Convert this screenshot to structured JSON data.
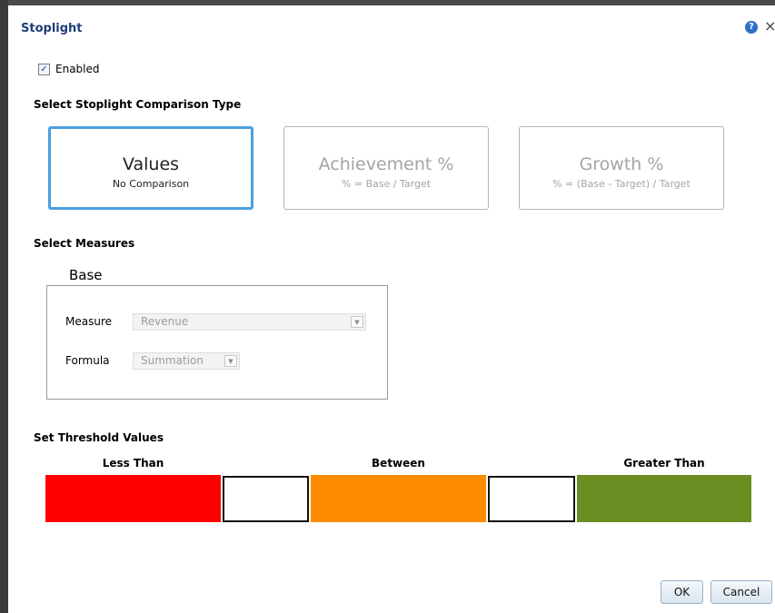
{
  "dialog": {
    "title": "Stoplight",
    "help_icon": "?",
    "close_icon": "×"
  },
  "enabled": {
    "label": "Enabled",
    "checked": true,
    "check_glyph": "✓"
  },
  "comparison_type": {
    "heading": "Select Stoplight Comparison Type",
    "options": [
      {
        "title": "Values",
        "subtitle": "No Comparison",
        "selected": true
      },
      {
        "title": "Achievement %",
        "subtitle": "% = Base / Target",
        "selected": false
      },
      {
        "title": "Growth %",
        "subtitle": "% = (Base - Target) / Target",
        "selected": false
      }
    ]
  },
  "measures": {
    "heading": "Select Measures",
    "base_label": "Base",
    "measure": {
      "label": "Measure",
      "value": "Revenue"
    },
    "formula": {
      "label": "Formula",
      "value": "Summation"
    },
    "dropdown_glyph": "▼"
  },
  "thresholds": {
    "heading": "Set Threshold Values",
    "less_than_label": "Less Than",
    "between_label": "Between",
    "greater_than_label": "Greater Than",
    "colors": {
      "less_than": "#ff0000",
      "between": "#ff8c00",
      "greater_than": "#6b8e23"
    },
    "input_1_value": "",
    "input_2_value": ""
  },
  "buttons": {
    "ok": "OK",
    "cancel": "Cancel"
  }
}
